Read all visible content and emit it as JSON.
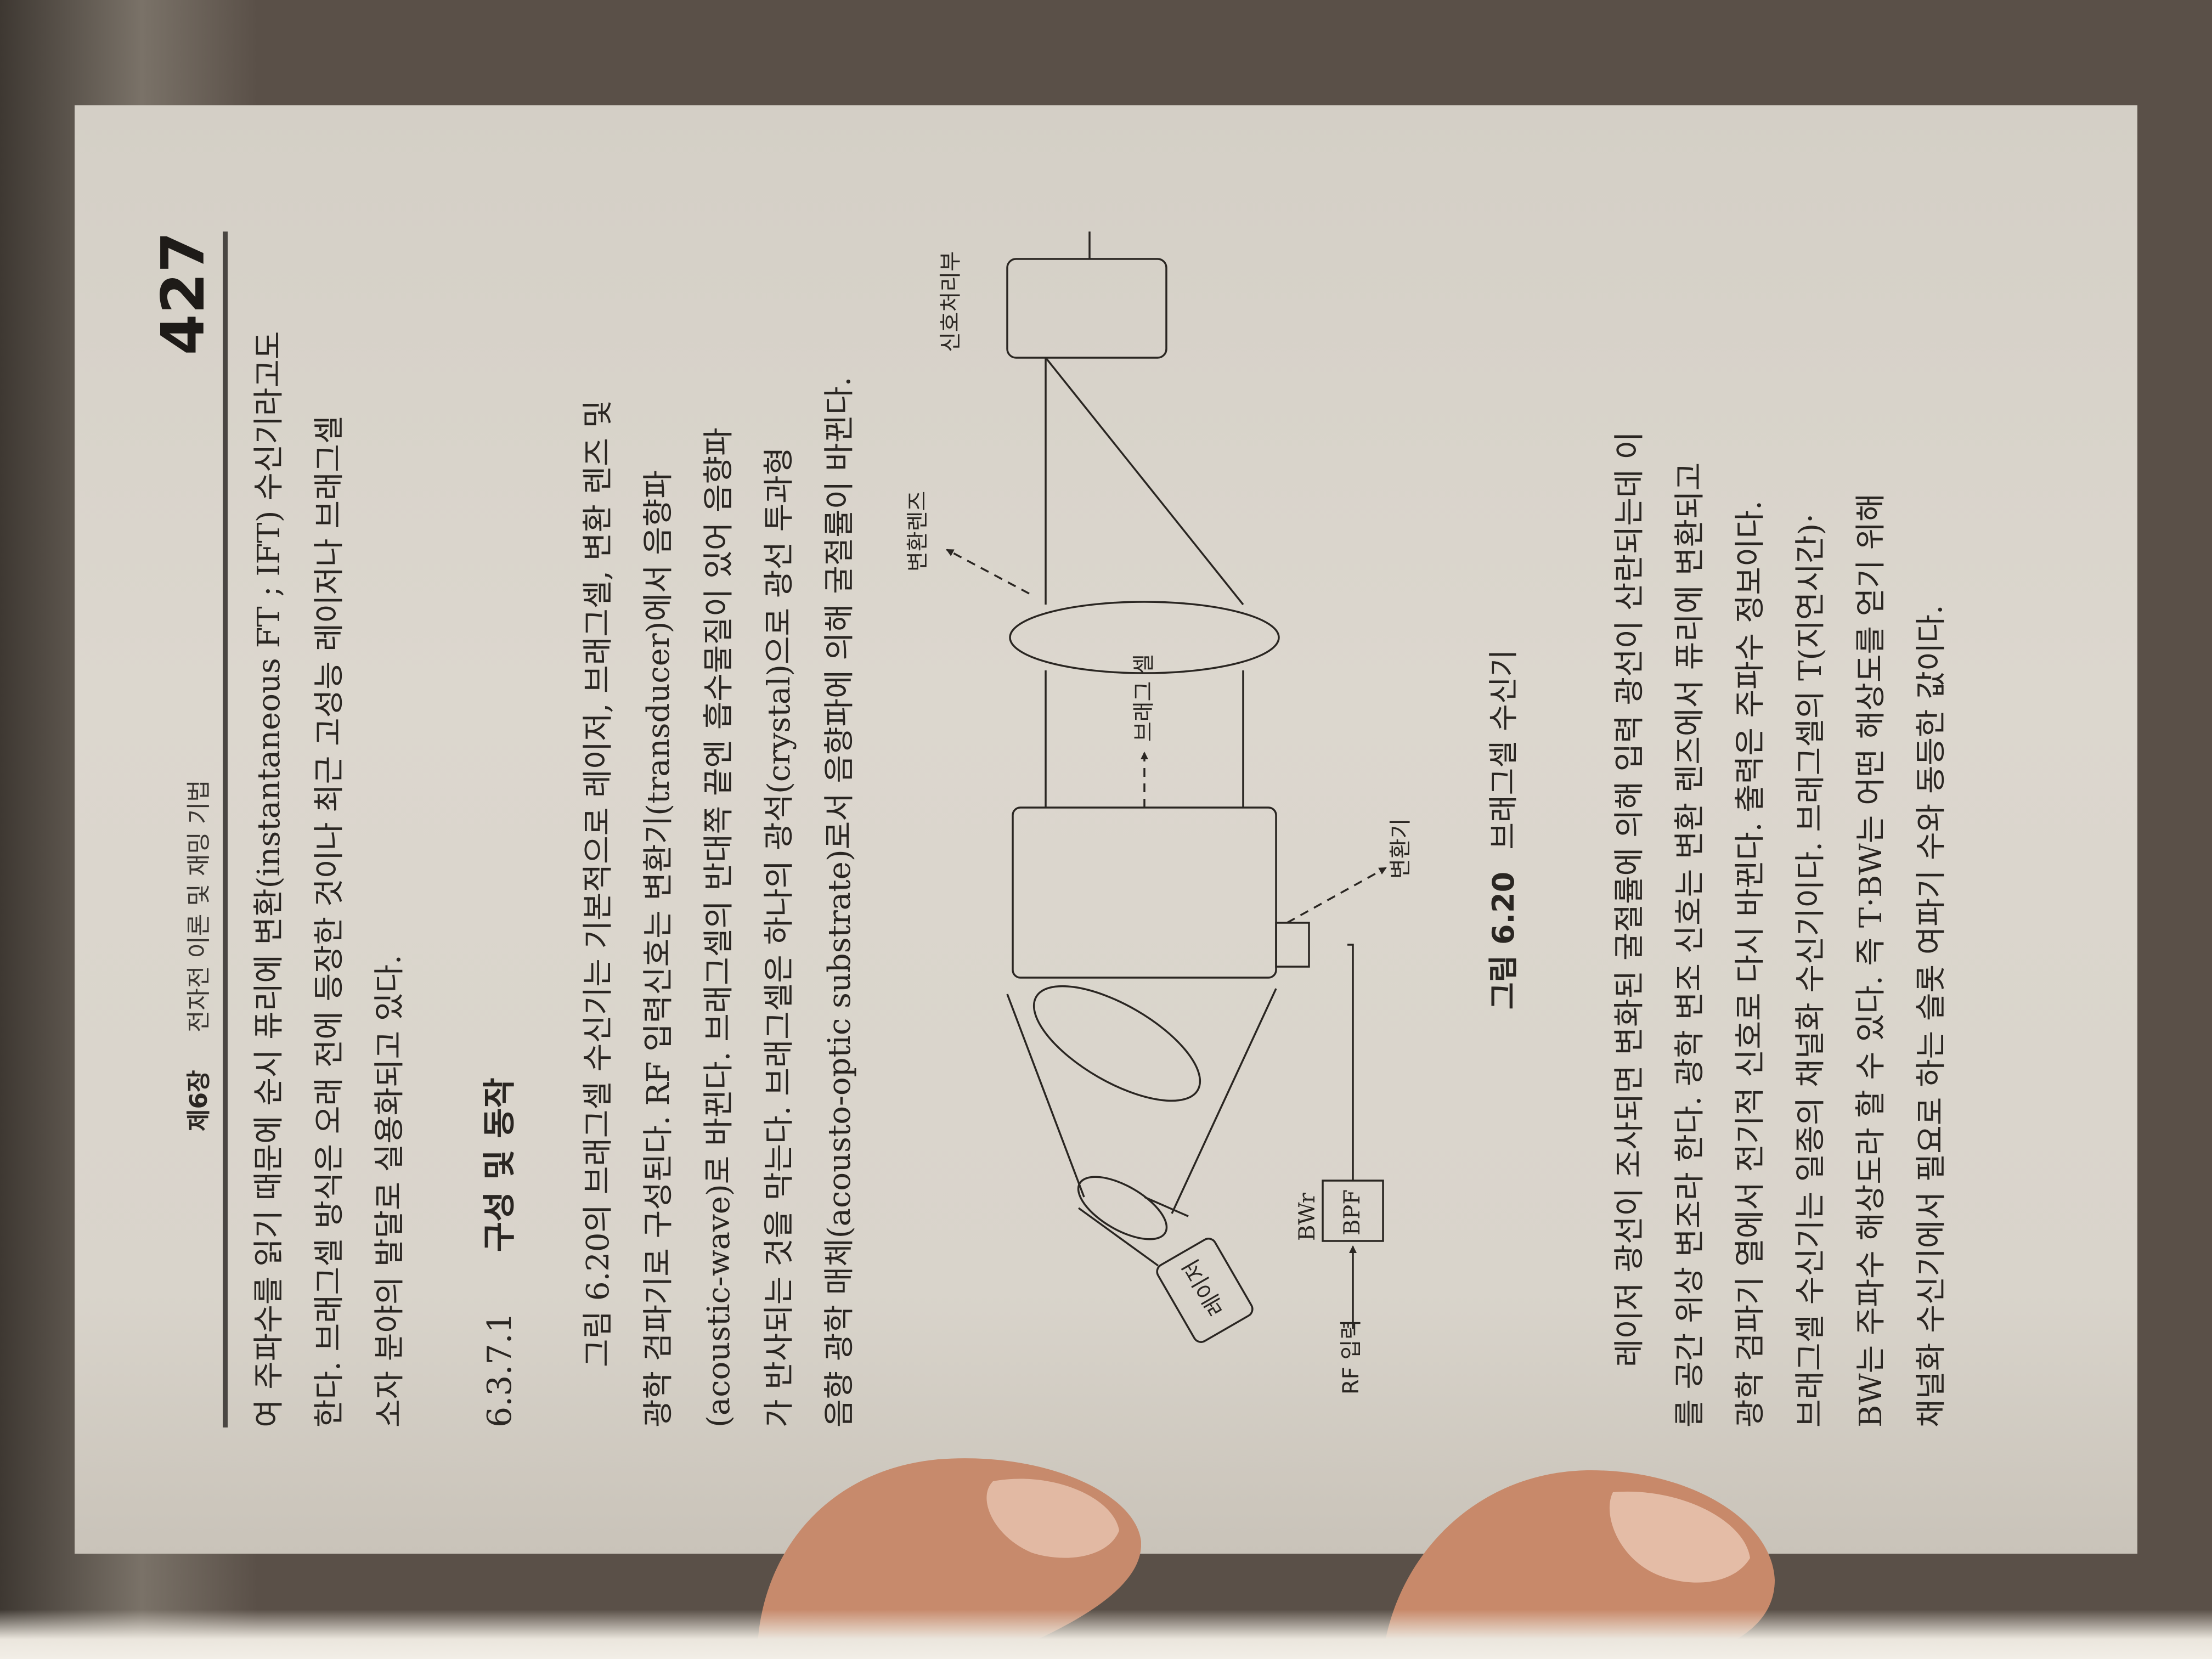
{
  "header": {
    "chapter": "제6장",
    "title": "전자전 이론 및 재밍 기법",
    "page_number": "427"
  },
  "intro_lines": [
    "여 주파수를 읽기 때문에 순시 퓨리에 변환(instantaneous FT ; IFT) 수신기라고도",
    "한다. 브래그셀 방식은 오래 전에 등장한 것이나 최근 고성능 레이저나 브래그셀",
    "소자 분야의 발달로 실용화되고 있다."
  ],
  "section": {
    "number": "6.3.7.1",
    "title": "구성 및 동작"
  },
  "body1_lines": [
    "그림 6.20의 브래그셀 수신기는 기본적으로 레이저, 브래그셀, 변환 렌즈 및",
    "광학 검파기로 구성된다. RF 입력신호는 변환기(transducer)에서 음향파",
    "(acoustic-wave)로 바뀐다. 브래그셀의 반대쪽 끝엔 흡수물질이 있어 음향파",
    "가 반사되는 것을 막는다. 브래그셀은 하나의 광석(crystal)으로 광선 투과형",
    "음향 광학 매체(acousto-optic substrate)로서 음향파에 의해 굴절률이 바뀐다."
  ],
  "diagram": {
    "labels": {
      "rf_input": "RF 입력",
      "bwr": "BWr",
      "bpf": "BPF",
      "laser": "레이저",
      "transducer": "변환기",
      "bragg_cell": "브래그 셀",
      "transform_lens": "변환렌즈",
      "signal_processor": "신호처리부"
    }
  },
  "caption": {
    "figure": "그림 6.20",
    "text": "브래그셀 수신기"
  },
  "body2_lines": [
    "레이저 광선이 조사되면 변화된 굴절률에 의해 입력 광선이 산란되는데 이",
    "를 공간 위상 변조라 한다. 광학 변조 신호는 변환 렌즈에서 퓨리에 변환되고",
    "광학 검파기 열에서 전기적 신호로 다시 바뀐다. 출력은 주파수 정보이다.",
    "브래그셀 수신기는 일종의 채널화 수신기이다. 브래그셀의 T(지연시간)·",
    "BW는 주파수 해상도라 할 수 있다. 즉 T·BW는 어떤 해상도를 얻기 위해",
    "채널화 수신기에서 필요로 하는 슬롯 여파기 수와 동등한 값이다."
  ]
}
